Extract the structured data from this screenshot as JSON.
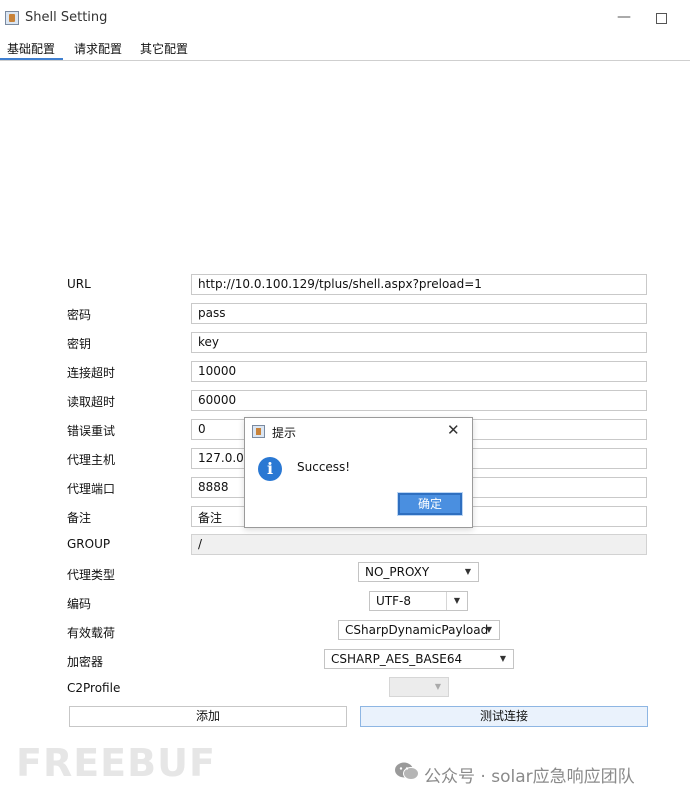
{
  "window": {
    "title": "Shell Setting",
    "app_icon": "java-cup-icon",
    "minimize_glyph": "—",
    "maximize_glyph": ""
  },
  "tabs": [
    {
      "label": "基础配置",
      "selected": true
    },
    {
      "label": "请求配置",
      "selected": false
    },
    {
      "label": "其它配置",
      "selected": false
    }
  ],
  "form": {
    "fields": [
      {
        "label": "URL",
        "value": "http://10.0.100.129/tplus/shell.aspx?preload=1"
      },
      {
        "label": "密码",
        "value": "pass"
      },
      {
        "label": "密钥",
        "value": "key"
      },
      {
        "label": "连接超时",
        "value": "10000"
      },
      {
        "label": "读取超时",
        "value": "60000"
      },
      {
        "label": "错误重试",
        "value": "0"
      },
      {
        "label": "代理主机",
        "value": "127.0.0.1"
      },
      {
        "label": "代理端口",
        "value": "8888"
      },
      {
        "label": "备注",
        "value": "备注"
      },
      {
        "label": "GROUP",
        "value": "/"
      }
    ],
    "combos": [
      {
        "label": "代理类型",
        "value": "NO_PROXY"
      },
      {
        "label": "编码",
        "value": "UTF-8"
      },
      {
        "label": "有效载荷",
        "value": "CSharpDynamicPayload"
      },
      {
        "label": "加密器",
        "value": "CSHARP_AES_BASE64"
      },
      {
        "label": "C2Profile",
        "value": ""
      }
    ],
    "dropdown_arrow": "▼",
    "buttons": {
      "add": "添加",
      "test": "测试连接"
    }
  },
  "dialog": {
    "title": "提示",
    "close_glyph": "✕",
    "info_glyph": "i",
    "message": "Success!",
    "ok_label": "确定",
    "accent": "#4a8fe0"
  },
  "watermark": {
    "logo": "FREEBUF",
    "source": "公众号 · solar应急响应团队"
  }
}
